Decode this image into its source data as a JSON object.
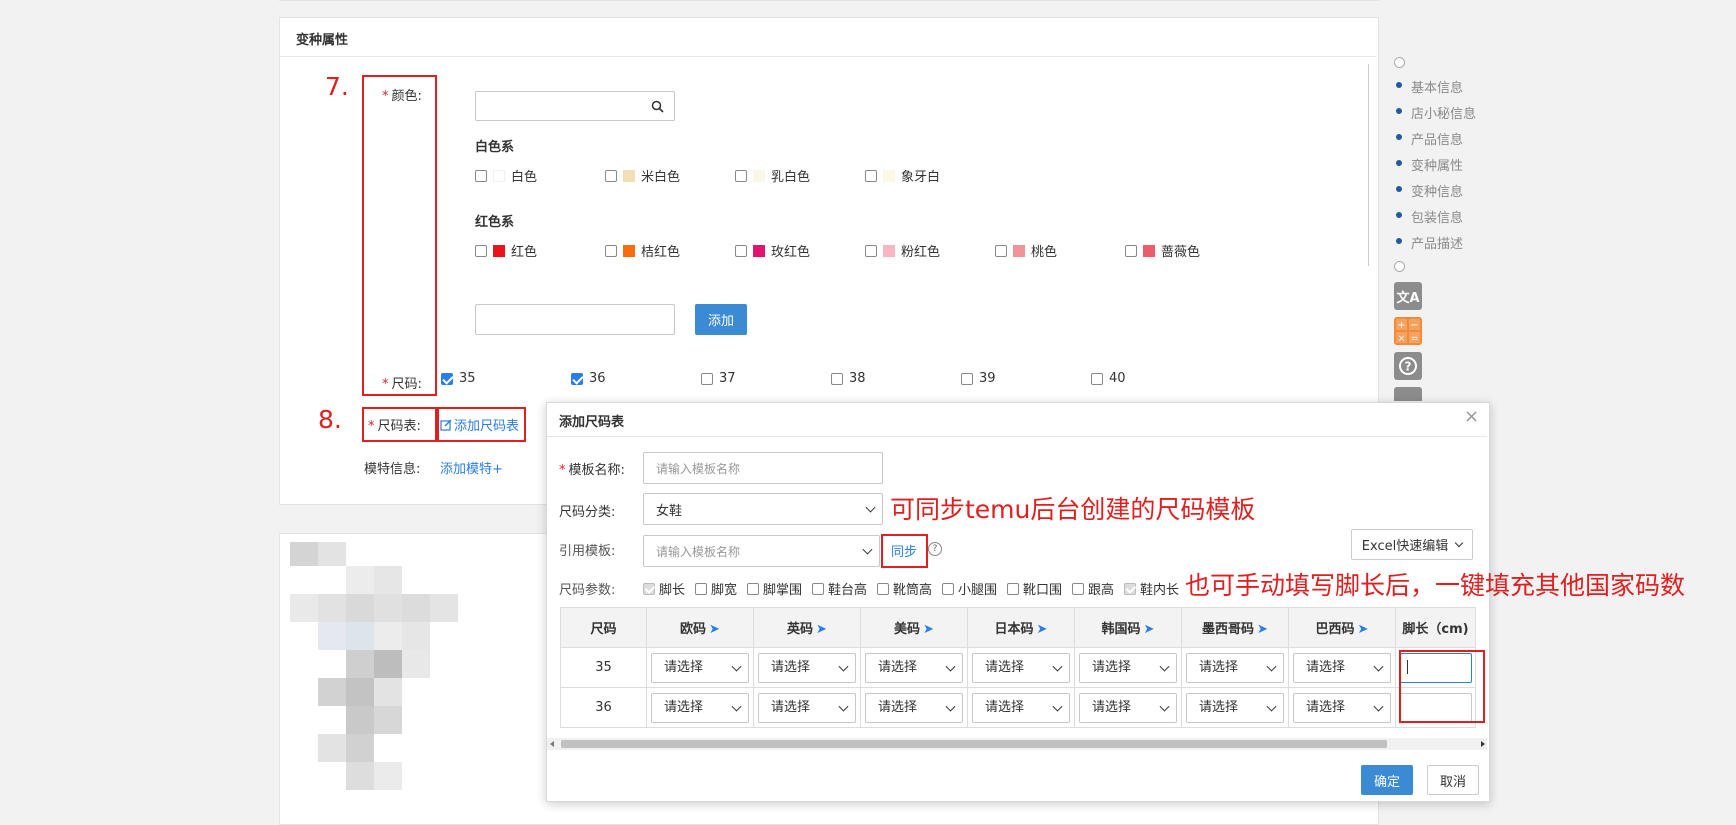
{
  "section": {
    "title": "变种属性"
  },
  "color": {
    "label": "颜色:",
    "groups": [
      {
        "title": "白色系",
        "options": [
          {
            "label": "白色",
            "swatch": "#ffffff"
          },
          {
            "label": "米白色",
            "swatch": "#f2dfb6"
          },
          {
            "label": "乳白色",
            "swatch": "#fbf7e6"
          },
          {
            "label": "象牙白",
            "swatch": "#fbf9e4"
          }
        ]
      },
      {
        "title": "红色系",
        "options": [
          {
            "label": "红色",
            "swatch": "#e8131b"
          },
          {
            "label": "桔红色",
            "swatch": "#f56d0f"
          },
          {
            "label": "玫红色",
            "swatch": "#e2146f"
          },
          {
            "label": "粉红色",
            "swatch": "#f7b6c2"
          },
          {
            "label": "桃色",
            "swatch": "#f0949b"
          },
          {
            "label": "蔷薇色",
            "swatch": "#ec5c6b"
          }
        ]
      }
    ],
    "add_label": "添加"
  },
  "size": {
    "label": "尺码:",
    "options": [
      {
        "label": "35",
        "checked": true
      },
      {
        "label": "36",
        "checked": true
      },
      {
        "label": "37",
        "checked": false
      },
      {
        "label": "38",
        "checked": false
      },
      {
        "label": "39",
        "checked": false
      },
      {
        "label": "40",
        "checked": false
      }
    ]
  },
  "size_chart": {
    "label": "尺码表:",
    "link": "添加尺码表"
  },
  "model": {
    "label": "模特信息:",
    "link": "添加模特+"
  },
  "annotations": {
    "step7": "7.",
    "step8": "8.",
    "sync_note": "可同步temu后台创建的尺码模板",
    "fill_note": "也可手动填写脚长后，一键填充其他国家码数"
  },
  "nav": {
    "items": [
      "基本信息",
      "店小秘信息",
      "产品信息",
      "变种属性",
      "变种信息",
      "包装信息",
      "产品描述"
    ]
  },
  "tools": {
    "translate": "文A"
  },
  "dialog": {
    "title": "添加尺码表",
    "template_name_label": "模板名称:",
    "template_name_placeholder": "请输入模板名称",
    "category_label": "尺码分类:",
    "category_value": "女鞋",
    "ref_label": "引用模板:",
    "ref_placeholder": "请输入模板名称",
    "sync_label": "同步",
    "help": "?",
    "excel_label": "Excel快速编辑",
    "params_label": "尺码参数:",
    "params": [
      {
        "label": "脚长",
        "checked": true,
        "disabled": true
      },
      {
        "label": "脚宽",
        "checked": false,
        "disabled": false
      },
      {
        "label": "脚掌围",
        "checked": false,
        "disabled": false
      },
      {
        "label": "鞋台高",
        "checked": false,
        "disabled": false
      },
      {
        "label": "靴筒高",
        "checked": false,
        "disabled": false
      },
      {
        "label": "小腿围",
        "checked": false,
        "disabled": false
      },
      {
        "label": "靴口围",
        "checked": false,
        "disabled": false
      },
      {
        "label": "跟高",
        "checked": false,
        "disabled": false
      },
      {
        "label": "鞋内长",
        "checked": true,
        "disabled": true
      }
    ],
    "table": {
      "headers": [
        "尺码",
        "欧码",
        "英码",
        "美码",
        "日本码",
        "韩国码",
        "墨西哥码",
        "巴西码",
        "脚长（cm)"
      ],
      "rows": [
        {
          "size": "35"
        },
        {
          "size": "36"
        }
      ],
      "select_placeholder": "请选择"
    },
    "confirm_label": "确定",
    "cancel_label": "取消",
    "close": "×"
  }
}
